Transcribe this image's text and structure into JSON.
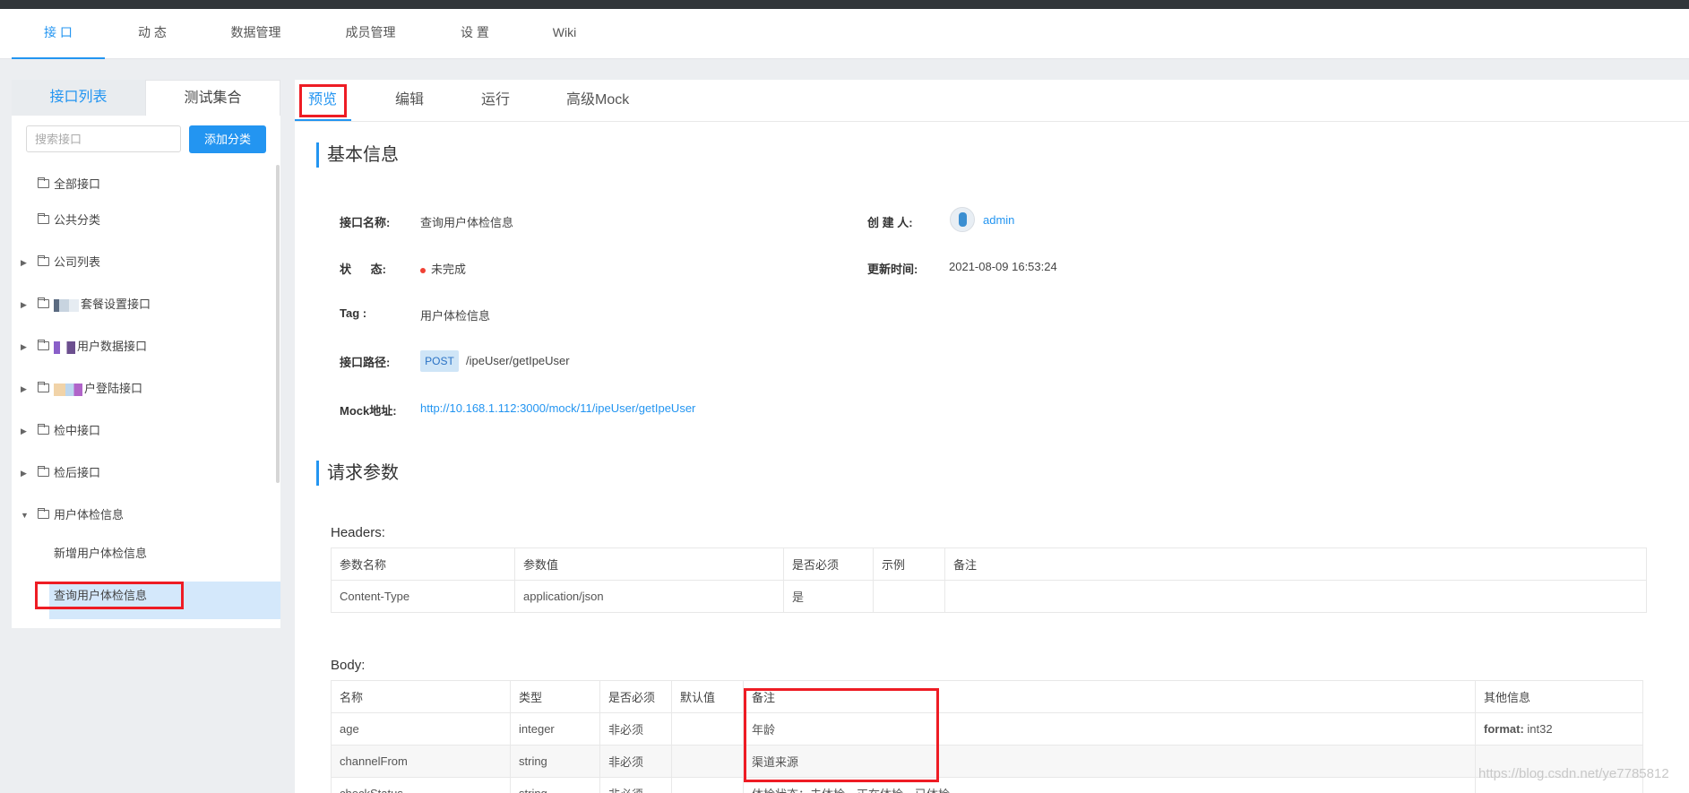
{
  "nav": {
    "tabs": [
      "接 口",
      "动 态",
      "数据管理",
      "成员管理",
      "设 置",
      "Wiki"
    ]
  },
  "sidebar": {
    "tabs": {
      "list": "接口列表",
      "test": "测试集合"
    },
    "search_placeholder": "搜索接口",
    "add_category": "添加分类",
    "tree": {
      "all": "全部接口",
      "public": "公共分类",
      "company": "公司列表",
      "setmeal": "套餐设置接口",
      "userdata": "用户数据接口",
      "login": "户登陆接口",
      "during": "检中接口",
      "after": "检后接口",
      "userexam": "用户体检信息",
      "add_exam": "新增用户体检信息",
      "query_exam": "查询用户体检信息"
    }
  },
  "main": {
    "tabs": {
      "preview": "预览",
      "edit": "编辑",
      "run": "运行",
      "mock": "高级Mock"
    },
    "basic_title": "基本信息",
    "info": {
      "name_label": "接口名称:",
      "name_value": "查询用户体检信息",
      "creator_label": "创 建 人:",
      "creator_value": "admin",
      "status_label": "状      态:",
      "status_value": "未完成",
      "updated_label": "更新时间:",
      "updated_value": "2021-08-09 16:53:24",
      "tag_label": "Tag :",
      "tag_value": "用户体检信息",
      "path_label": "接口路径:",
      "method": "POST",
      "path_value": "/ipeUser/getIpeUser",
      "mock_label": "Mock地址:",
      "mock_value": "http://10.168.1.112:3000/mock/11/ipeUser/getIpeUser"
    },
    "request_title": "请求参数",
    "headers": {
      "label": "Headers:",
      "columns": [
        "参数名称",
        "参数值",
        "是否必须",
        "示例",
        "备注"
      ],
      "rows": [
        [
          "Content-Type",
          "application/json",
          "是",
          "",
          ""
        ]
      ]
    },
    "body": {
      "label": "Body:",
      "columns": [
        "名称",
        "类型",
        "是否必须",
        "默认值",
        "备注",
        "其他信息"
      ],
      "rows": [
        {
          "name": "age",
          "type": "integer",
          "required": "非必须",
          "default": "",
          "note": "年龄",
          "other_key": "format:",
          "other_val": " int32"
        },
        {
          "name": "channelFrom",
          "type": "string",
          "required": "非必须",
          "default": "",
          "note": "渠道来源",
          "other_key": "",
          "other_val": ""
        },
        {
          "name": "checkStatus",
          "type": "string",
          "required": "非必须",
          "default": "",
          "note": "体检状态：未体检、正在体检、已体检",
          "other_key": "",
          "other_val": ""
        }
      ]
    }
  },
  "watermark": "https://blog.csdn.net/ye7785812",
  "colors": {
    "accent": "#2395f1",
    "highlight_box": "#ee1c24",
    "status_dot": "#f04134"
  }
}
